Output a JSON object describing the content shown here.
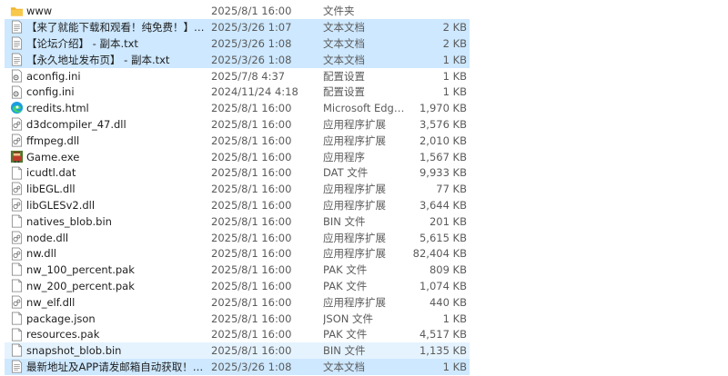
{
  "files": [
    {
      "name": "www",
      "date": "2025/8/1 16:00",
      "type": "文件夹",
      "size": "",
      "icon": "folder-icon"
    },
    {
      "name": "【来了就能下载和观看！纯免费！】 - 副...",
      "date": "2025/3/26 1:07",
      "type": "文本文档",
      "size": "2 KB",
      "icon": "text-document-icon",
      "state": "selected"
    },
    {
      "name": "【论坛介绍】 - 副本.txt",
      "date": "2025/3/26 1:08",
      "type": "文本文档",
      "size": "2 KB",
      "icon": "text-document-icon",
      "state": "selected"
    },
    {
      "name": "【永久地址发布页】 - 副本.txt",
      "date": "2025/3/26 1:08",
      "type": "文本文档",
      "size": "1 KB",
      "icon": "text-document-icon",
      "state": "selected"
    },
    {
      "name": "aconfig.ini",
      "date": "2025/7/8 4:37",
      "type": "配置设置",
      "size": "1 KB",
      "icon": "settings-file-icon"
    },
    {
      "name": "config.ini",
      "date": "2024/11/24 4:18",
      "type": "配置设置",
      "size": "1 KB",
      "icon": "settings-file-icon"
    },
    {
      "name": "credits.html",
      "date": "2025/8/1 16:00",
      "type": "Microsoft Edge ...",
      "size": "1,970 KB",
      "icon": "edge-icon"
    },
    {
      "name": "d3dcompiler_47.dll",
      "date": "2025/8/1 16:00",
      "type": "应用程序扩展",
      "size": "3,576 KB",
      "icon": "dll-icon"
    },
    {
      "name": "ffmpeg.dll",
      "date": "2025/8/1 16:00",
      "type": "应用程序扩展",
      "size": "2,010 KB",
      "icon": "dll-icon"
    },
    {
      "name": "Game.exe",
      "date": "2025/8/1 16:00",
      "type": "应用程序",
      "size": "1,567 KB",
      "icon": "game-exe-icon"
    },
    {
      "name": "icudtl.dat",
      "date": "2025/8/1 16:00",
      "type": "DAT 文件",
      "size": "9,933 KB",
      "icon": "blank-file-icon"
    },
    {
      "name": "libEGL.dll",
      "date": "2025/8/1 16:00",
      "type": "应用程序扩展",
      "size": "77 KB",
      "icon": "dll-icon"
    },
    {
      "name": "libGLESv2.dll",
      "date": "2025/8/1 16:00",
      "type": "应用程序扩展",
      "size": "3,644 KB",
      "icon": "dll-icon"
    },
    {
      "name": "natives_blob.bin",
      "date": "2025/8/1 16:00",
      "type": "BIN 文件",
      "size": "201 KB",
      "icon": "blank-file-icon"
    },
    {
      "name": "node.dll",
      "date": "2025/8/1 16:00",
      "type": "应用程序扩展",
      "size": "5,615 KB",
      "icon": "dll-icon"
    },
    {
      "name": "nw.dll",
      "date": "2025/8/1 16:00",
      "type": "应用程序扩展",
      "size": "82,404 KB",
      "icon": "dll-icon"
    },
    {
      "name": "nw_100_percent.pak",
      "date": "2025/8/1 16:00",
      "type": "PAK 文件",
      "size": "809 KB",
      "icon": "blank-file-icon"
    },
    {
      "name": "nw_200_percent.pak",
      "date": "2025/8/1 16:00",
      "type": "PAK 文件",
      "size": "1,074 KB",
      "icon": "blank-file-icon"
    },
    {
      "name": "nw_elf.dll",
      "date": "2025/8/1 16:00",
      "type": "应用程序扩展",
      "size": "440 KB",
      "icon": "dll-icon"
    },
    {
      "name": "package.json",
      "date": "2025/8/1 16:00",
      "type": "JSON 文件",
      "size": "1 KB",
      "icon": "blank-file-icon"
    },
    {
      "name": "resources.pak",
      "date": "2025/8/1 16:00",
      "type": "PAK 文件",
      "size": "4,517 KB",
      "icon": "blank-file-icon"
    },
    {
      "name": "snapshot_blob.bin",
      "date": "2025/8/1 16:00",
      "type": "BIN 文件",
      "size": "1,135 KB",
      "icon": "blank-file-icon",
      "state": "hover"
    },
    {
      "name": "最新地址及APP请发邮箱自动获取！！！",
      "date": "2025/3/26 1:08",
      "type": "文本文档",
      "size": "1 KB",
      "icon": "text-document-icon",
      "state": "selected"
    }
  ],
  "colors": {
    "selected": "#cde8ff",
    "hover": "#e5f3ff",
    "folder": "#f8c84c"
  }
}
